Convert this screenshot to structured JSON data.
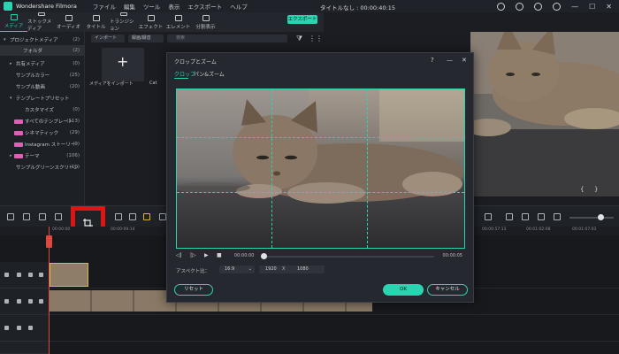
{
  "app": {
    "name": "Wondershare Filmora",
    "menu": [
      "ファイル",
      "編集",
      "ツール",
      "表示",
      "エクスポート",
      "ヘルプ"
    ],
    "doc_title": "タイトルなし : 00:00:40:15"
  },
  "toolbar": {
    "tabs": [
      {
        "label": "メディア",
        "icon": "folder-icon",
        "active": true
      },
      {
        "label": "ストックメディア",
        "icon": "stock-icon",
        "active": false
      },
      {
        "label": "オーディオ",
        "icon": "music-icon",
        "active": false
      },
      {
        "label": "タイトル",
        "icon": "text-icon",
        "active": false
      },
      {
        "label": "トランジション",
        "icon": "transition-icon",
        "active": false
      },
      {
        "label": "エフェクト",
        "icon": "effects-icon",
        "active": false
      },
      {
        "label": "エレメント",
        "icon": "element-icon",
        "active": false
      },
      {
        "label": "分割表示",
        "icon": "split-icon",
        "active": false
      }
    ],
    "export_label": "エクスポート"
  },
  "sidebar": {
    "items": [
      {
        "label": "プロジェクトメディア",
        "count": "(2)",
        "level": 0,
        "arrow": "▾"
      },
      {
        "label": "フォルダ",
        "count": "(2)",
        "level": 1,
        "active": true
      },
      {
        "label": "共有メディア",
        "count": "(0)",
        "level": 0,
        "arrow": "▸"
      },
      {
        "label": "サンプルカラー",
        "count": "(25)",
        "level": 1
      },
      {
        "label": "サンプル動画",
        "count": "(20)",
        "level": 1
      },
      {
        "label": "テンプレートプリセット",
        "count": "",
        "level": 0,
        "arrow": "▾"
      },
      {
        "label": "カスタマイズ",
        "count": "(0)",
        "level": 1
      },
      {
        "label": "すべてのテンプレート",
        "count": "(113)",
        "level": 1,
        "badge": true
      },
      {
        "label": "シネマティック",
        "count": "(29)",
        "level": 1,
        "badge": true
      },
      {
        "label": "Instagram ストーリー",
        "count": "(9)",
        "level": 1,
        "badge": true
      },
      {
        "label": "テーマ",
        "count": "(106)",
        "level": 0,
        "arrow": "▸",
        "badge": true
      },
      {
        "label": "サンプルグリーンスクリーン",
        "count": "(10)",
        "level": 1
      }
    ]
  },
  "media": {
    "import_dropdown": "インポート",
    "record_dropdown": "録画/録音",
    "search_placeholder": "検索",
    "import_tile_label": "メディアをインポート",
    "clip_label": "Cat"
  },
  "modal": {
    "title": "クロップとズーム",
    "tabs": [
      "クロップ",
      "パン&ズーム"
    ],
    "time_current": "00:00:00",
    "time_end": "00:00:05",
    "aspect_label": "アスペクト比：",
    "aspect_value": "16:9",
    "width": "1920",
    "height": "1080",
    "x_sep": "X",
    "reset_label": "リセット",
    "ok_label": "OK",
    "cancel_label": "キャンセル"
  },
  "timeline": {
    "ruler": [
      "00:00:00",
      "00:00:09:14",
      "00:00:57:13",
      "00:01:02:08",
      "00:01:07:03"
    ]
  }
}
